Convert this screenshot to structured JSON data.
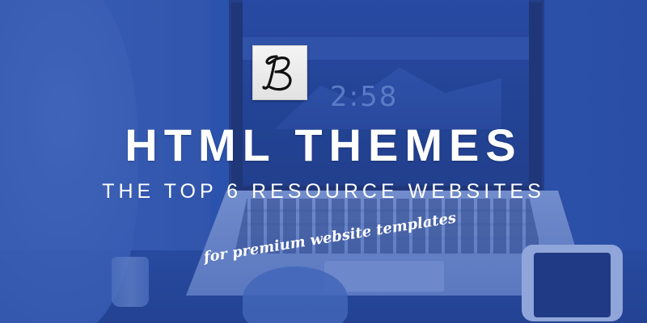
{
  "banner": {
    "logo_letter": "B",
    "title": "HTML THEMES",
    "subtitle": "THE TOP 6 RESOURCE WEBSITES",
    "tagline": "for premium website templates"
  },
  "background": {
    "screen_clock": "2:58",
    "colors": {
      "tint": "#2d55ad",
      "text": "#ffffff",
      "logo_bg": "#eeeeee",
      "logo_letter": "#111111"
    }
  }
}
